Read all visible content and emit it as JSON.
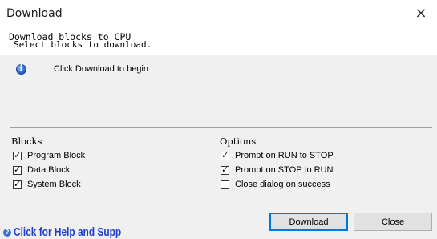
{
  "window": {
    "title": "Download",
    "close_glyph": "×"
  },
  "header": {
    "title": "Download blocks to CPU",
    "subtitle": "Select blocks to download."
  },
  "status": {
    "icon": "info-icon",
    "message": "Click Download to begin"
  },
  "blocks": {
    "label": "Blocks",
    "items": [
      {
        "label": "Program Block",
        "checked": true
      },
      {
        "label": "Data Block",
        "checked": true
      },
      {
        "label": "System Block",
        "checked": true
      }
    ]
  },
  "options": {
    "label": "Options",
    "items": [
      {
        "label": "Prompt on RUN to STOP",
        "checked": true
      },
      {
        "label": "Prompt on STOP to RUN",
        "checked": true
      },
      {
        "label": "Close dialog on success",
        "checked": false
      }
    ]
  },
  "help": {
    "text": "Click for Help and Supp",
    "icon": "help-icon",
    "color": "#1f3fcc"
  },
  "buttons": {
    "download": "Download",
    "close": "Close"
  }
}
